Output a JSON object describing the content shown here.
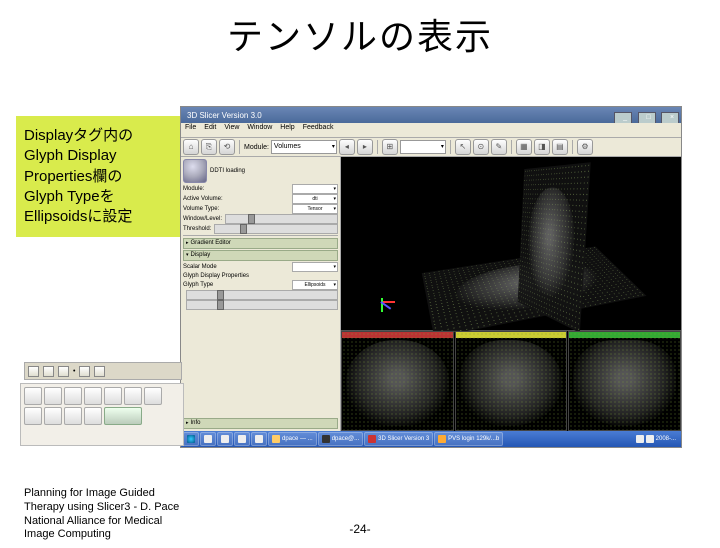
{
  "title": "テンソルの表示",
  "callout": {
    "line1": "Displayタグ内の",
    "line2": "Glyph Display",
    "line3": "Properties欄の",
    "line4": "Glyph Typeを",
    "line5": "Ellipsoidsに設定"
  },
  "window": {
    "title": "3D Slicer Version 3.0",
    "menus": [
      "File",
      "Edit",
      "View",
      "Window",
      "Help",
      "Feedback"
    ]
  },
  "toolbar": {
    "module_label": "Module:",
    "module_value": "Volumes"
  },
  "left_panel": {
    "header": "DDTI loading",
    "rows": [
      {
        "label": "Module:",
        "value": ""
      },
      {
        "label": "Active Volume:",
        "value": "dti"
      },
      {
        "label": "Volume Type:",
        "value": "Tensor"
      }
    ],
    "window_level": "Window/Level:",
    "threshold": "Threshold:",
    "sections": [
      "Gradient Editor",
      "Display",
      "Scalar Mode",
      "Glyph Display Properties"
    ],
    "glyph_type_label": "Glyph Type",
    "glyph_type_value": "Ellipsoids",
    "info_section": "Info"
  },
  "slices": {
    "red": "#b33",
    "yellow": "#cc3",
    "green": "#3a3"
  },
  "taskbar": {
    "items": [
      "",
      "",
      "",
      "",
      "",
      "dpace — ...",
      "dpace@...",
      "3D Slicer Version 3",
      "PVS login 129k/...b",
      "",
      "",
      "2008-..."
    ]
  },
  "footer": {
    "l1": "Planning for Image Guided",
    "l2": "Therapy using Slicer3 - D. Pace",
    "l3": "National Alliance for Medical",
    "l4": "Image Computing"
  },
  "page_number": "-24-"
}
